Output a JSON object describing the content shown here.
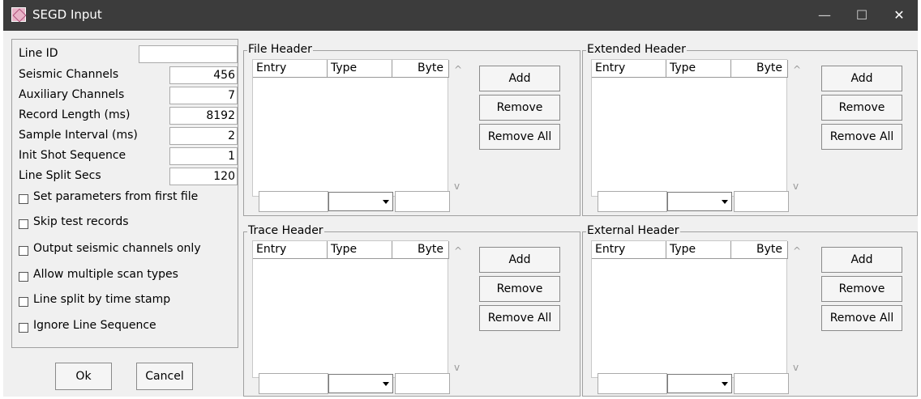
{
  "window": {
    "title": "SEGD Input",
    "icon": "app-icon",
    "controls": {
      "minimize": "—",
      "maximize": "☐",
      "close": "✕"
    }
  },
  "fields": [
    {
      "label": "Line ID",
      "value": ""
    },
    {
      "label": "Seismic Channels",
      "value": "456"
    },
    {
      "label": "Auxiliary Channels",
      "value": "7"
    },
    {
      "label": "Record Length (ms)",
      "value": "8192"
    },
    {
      "label": "Sample Interval (ms)",
      "value": "2"
    },
    {
      "label": "Init Shot Sequence",
      "value": "1"
    },
    {
      "label": "Line Split Secs",
      "value": "120"
    }
  ],
  "checkboxes": [
    {
      "label": "Set parameters from first file",
      "checked": false
    },
    {
      "label": "Skip test records",
      "checked": false
    },
    {
      "label": "Output seismic channels only",
      "checked": false
    },
    {
      "label": "Allow multiple scan types",
      "checked": false
    },
    {
      "label": "Line split by time stamp",
      "checked": false
    },
    {
      "label": "Ignore Line Sequence",
      "checked": false
    }
  ],
  "buttons": {
    "ok": "Ok",
    "cancel": "Cancel"
  },
  "columns": {
    "entry": "Entry",
    "type": "Type",
    "byte": "Byte"
  },
  "group_buttons": {
    "add": "Add",
    "remove": "Remove",
    "remove_all": "Remove All"
  },
  "groups": [
    {
      "title": "File Header"
    },
    {
      "title": "Extended Header"
    },
    {
      "title": "Trace Header"
    },
    {
      "title": "External Header"
    }
  ]
}
